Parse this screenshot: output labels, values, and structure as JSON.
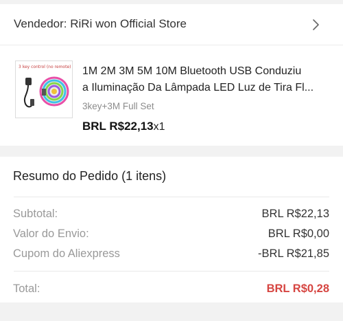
{
  "seller": {
    "label": "Vendedor: RiRi won Official Store",
    "chevron_icon": "chevron-right-icon"
  },
  "product": {
    "thumbnail_caption": "3 key control (no remote)",
    "title_line1": "1M 2M 3M 5M 10M Bluetooth USB Conduziu",
    "title_line2": "a Iluminação Da Lâmpada LED Luz de Tira Fl...",
    "variant": "3key+3M Full Set",
    "price": "BRL R$22,13",
    "quantity": "x1"
  },
  "summary": {
    "title": "Resumo do Pedido (1 itens)",
    "rows": [
      {
        "label": "Subtotal:",
        "value": "BRL R$22,13"
      },
      {
        "label": "Valor do Envio:",
        "value": "BRL R$0,00"
      },
      {
        "label": "Cupom do Aliexpress",
        "value": "-BRL R$21,85"
      }
    ],
    "total_label": "Total:",
    "total_value": "BRL R$0,28"
  },
  "colors": {
    "background": "#f2f2f2",
    "card": "#ffffff",
    "total_accent": "#d64541",
    "muted_text": "#999999"
  }
}
